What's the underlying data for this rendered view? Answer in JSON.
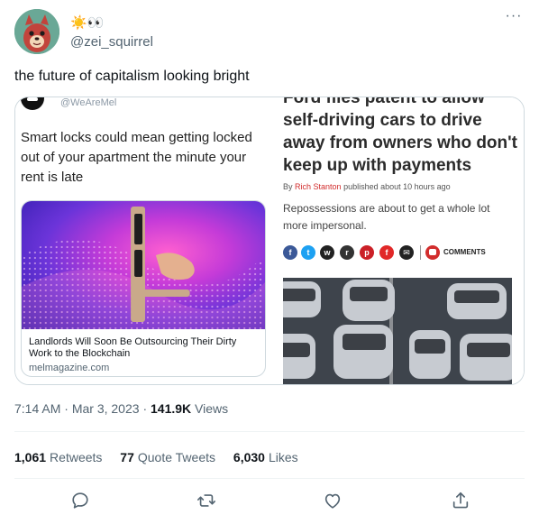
{
  "author": {
    "display_name": "☀️👀",
    "handle": "@zei_squirrel"
  },
  "more_glyph": "···",
  "tweet_text": "the future of capitalism looking bright",
  "embedded_left": {
    "handle": "@WeAreMel",
    "headline": "Smart locks could mean getting locked out of your apartment the minute your rent is late",
    "card_title": "Landlords Will Soon Be Outsourcing Their Dirty Work to the Blockchain",
    "card_domain": "melmagazine.com"
  },
  "embedded_right": {
    "headline": "Ford files patent to allow self-driving cars to drive away from owners who don't keep up with payments",
    "byline_prefix": "By",
    "byline_author": "Rich Stanton",
    "byline_suffix": "published about 10 hours ago",
    "dek": "Repossessions are about to get a whole lot more impersonal.",
    "comments_label": "COMMENTS",
    "share_icons": [
      {
        "name": "facebook-icon",
        "glyph": "f",
        "color": "#3b5998"
      },
      {
        "name": "twitter-icon",
        "glyph": "t",
        "color": "#1da1f2"
      },
      {
        "name": "whatsapp-icon",
        "glyph": "w",
        "color": "#222222"
      },
      {
        "name": "reddit-icon",
        "glyph": "r",
        "color": "#333333"
      },
      {
        "name": "pinterest-icon",
        "glyph": "p",
        "color": "#cb2027"
      },
      {
        "name": "flipboard-icon",
        "glyph": "f",
        "color": "#e12828"
      },
      {
        "name": "email-icon",
        "glyph": "✉",
        "color": "#222222"
      }
    ]
  },
  "meta": {
    "time": "7:14 AM",
    "separator": "·",
    "date": "Mar 3, 2023",
    "views_count": "141.9K",
    "views_label": "Views"
  },
  "stats": {
    "retweets_count": "1,061",
    "retweets_label": "Retweets",
    "quotes_count": "77",
    "quotes_label": "Quote Tweets",
    "likes_count": "6,030",
    "likes_label": "Likes"
  },
  "colors": {
    "accent": "#1d9bf0",
    "secondary_text": "#536471",
    "primary_text": "#0f1419"
  }
}
